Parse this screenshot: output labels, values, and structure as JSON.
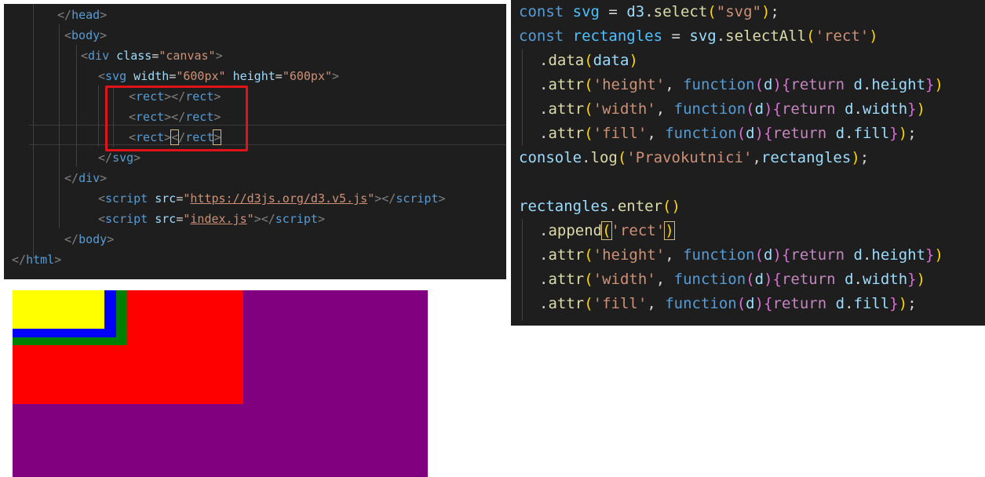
{
  "html_editor": {
    "lines": [
      [
        [
          "c-punct",
          "</"
        ],
        [
          "c-tag",
          "head"
        ],
        [
          "c-punct",
          ">"
        ]
      ],
      [
        [
          "c-punct",
          "<"
        ],
        [
          "c-tag",
          "body"
        ],
        [
          "c-punct",
          ">"
        ]
      ],
      [
        [
          "c-punct",
          "<"
        ],
        [
          "c-tag",
          "div"
        ],
        [
          "c-text",
          " "
        ],
        [
          "c-attr",
          "class"
        ],
        [
          "c-text",
          "="
        ],
        [
          "c-str",
          "\"canvas\""
        ],
        [
          "c-punct",
          ">"
        ]
      ],
      [
        [
          "c-punct",
          "<"
        ],
        [
          "c-tag",
          "svg"
        ],
        [
          "c-text",
          " "
        ],
        [
          "c-attr",
          "width"
        ],
        [
          "c-text",
          "="
        ],
        [
          "c-str",
          "\"600px\""
        ],
        [
          "c-text",
          " "
        ],
        [
          "c-attr",
          "height"
        ],
        [
          "c-text",
          "="
        ],
        [
          "c-str",
          "\"600px\""
        ],
        [
          "c-punct",
          ">"
        ]
      ],
      [
        [
          "c-punct",
          "<"
        ],
        [
          "c-tag",
          "rect"
        ],
        [
          "c-punct",
          "></"
        ],
        [
          "c-tag",
          "rect"
        ],
        [
          "c-punct",
          ">"
        ]
      ],
      [
        [
          "c-punct",
          "<"
        ],
        [
          "c-tag",
          "rect"
        ],
        [
          "c-punct",
          "></"
        ],
        [
          "c-tag",
          "rect"
        ],
        [
          "c-punct",
          ">"
        ]
      ],
      [
        [
          "c-punct",
          "<"
        ],
        [
          "c-tag",
          "rect"
        ],
        [
          "c-punct",
          ">"
        ],
        [
          "c-punct bracket-box",
          "<"
        ],
        [
          "c-punct",
          "/"
        ],
        [
          "c-tag",
          "rect"
        ],
        [
          "c-punct bracket-box",
          ">"
        ]
      ],
      [
        [
          "c-punct",
          "</"
        ],
        [
          "c-tag",
          "svg"
        ],
        [
          "c-punct",
          ">"
        ]
      ],
      [
        [
          "c-punct",
          "</"
        ],
        [
          "c-tag",
          "div"
        ],
        [
          "c-punct",
          ">"
        ]
      ],
      [
        [
          "c-punct",
          "<"
        ],
        [
          "c-tag",
          "script"
        ],
        [
          "c-text",
          " "
        ],
        [
          "c-attr",
          "src"
        ],
        [
          "c-text",
          "="
        ],
        [
          "c-str",
          "\""
        ],
        [
          "c-str c-ul",
          "https://d3js.org/d3.v5.js"
        ],
        [
          "c-str",
          "\""
        ],
        [
          "c-punct",
          "></"
        ],
        [
          "c-tag",
          "script"
        ],
        [
          "c-punct",
          ">"
        ]
      ],
      [
        [
          "c-punct",
          "<"
        ],
        [
          "c-tag",
          "script"
        ],
        [
          "c-text",
          " "
        ],
        [
          "c-attr",
          "src"
        ],
        [
          "c-text",
          "="
        ],
        [
          "c-str",
          "\""
        ],
        [
          "c-str c-ul",
          "index.js"
        ],
        [
          "c-str",
          "\""
        ],
        [
          "c-punct",
          "></"
        ],
        [
          "c-tag",
          "script"
        ],
        [
          "c-punct",
          ">"
        ]
      ],
      [
        [
          "c-punct",
          "</"
        ],
        [
          "c-tag",
          "body"
        ],
        [
          "c-punct",
          ">"
        ]
      ],
      [
        [
          "c-punct",
          "</"
        ],
        [
          "c-tag",
          "html"
        ],
        [
          "c-punct",
          ">"
        ]
      ]
    ]
  },
  "js_editor": {
    "lines": [
      [
        [
          "c-kw",
          "const"
        ],
        [
          "c-text",
          " "
        ],
        [
          "c-var",
          "svg"
        ],
        [
          "c-text",
          " = "
        ],
        [
          "c-id",
          "d3"
        ],
        [
          "c-text",
          "."
        ],
        [
          "c-fn",
          "select"
        ],
        [
          "c-p1",
          "("
        ],
        [
          "c-str",
          "\"svg\""
        ],
        [
          "c-p1",
          ")"
        ],
        [
          "c-text",
          ";"
        ]
      ],
      [
        [
          "c-kw",
          "const"
        ],
        [
          "c-text",
          " "
        ],
        [
          "c-var",
          "rectangles"
        ],
        [
          "c-text",
          " = "
        ],
        [
          "c-id",
          "svg"
        ],
        [
          "c-text",
          "."
        ],
        [
          "c-fn",
          "selectAll"
        ],
        [
          "c-p1",
          "("
        ],
        [
          "c-str",
          "'rect'"
        ],
        [
          "c-p1",
          ")"
        ]
      ],
      [
        [
          "c-text",
          "."
        ],
        [
          "c-fn",
          "data"
        ],
        [
          "c-p1",
          "("
        ],
        [
          "c-id",
          "data"
        ],
        [
          "c-p1",
          ")"
        ]
      ],
      [
        [
          "c-text",
          "."
        ],
        [
          "c-fn",
          "attr"
        ],
        [
          "c-p1",
          "("
        ],
        [
          "c-str",
          "'height'"
        ],
        [
          "c-text",
          ", "
        ],
        [
          "c-kw",
          "function"
        ],
        [
          "c-p2",
          "("
        ],
        [
          "c-id",
          "d"
        ],
        [
          "c-p2",
          ")"
        ],
        [
          "c-p2",
          "{"
        ],
        [
          "c-ctrl",
          "return"
        ],
        [
          "c-text",
          " "
        ],
        [
          "c-id",
          "d"
        ],
        [
          "c-text",
          "."
        ],
        [
          "c-id",
          "height"
        ],
        [
          "c-p2",
          "}"
        ],
        [
          "c-p1",
          ")"
        ]
      ],
      [
        [
          "c-text",
          "."
        ],
        [
          "c-fn",
          "attr"
        ],
        [
          "c-p1",
          "("
        ],
        [
          "c-str",
          "'width'"
        ],
        [
          "c-text",
          ", "
        ],
        [
          "c-kw",
          "function"
        ],
        [
          "c-p2",
          "("
        ],
        [
          "c-id",
          "d"
        ],
        [
          "c-p2",
          ")"
        ],
        [
          "c-p2",
          "{"
        ],
        [
          "c-ctrl",
          "return"
        ],
        [
          "c-text",
          " "
        ],
        [
          "c-id",
          "d"
        ],
        [
          "c-text",
          "."
        ],
        [
          "c-id",
          "width"
        ],
        [
          "c-p2",
          "}"
        ],
        [
          "c-p1",
          ")"
        ]
      ],
      [
        [
          "c-text",
          "."
        ],
        [
          "c-fn",
          "attr"
        ],
        [
          "c-p1",
          "("
        ],
        [
          "c-str",
          "'fill'"
        ],
        [
          "c-text",
          ", "
        ],
        [
          "c-kw",
          "function"
        ],
        [
          "c-p2",
          "("
        ],
        [
          "c-id",
          "d"
        ],
        [
          "c-p2",
          ")"
        ],
        [
          "c-p2",
          "{"
        ],
        [
          "c-ctrl",
          "return"
        ],
        [
          "c-text",
          " "
        ],
        [
          "c-id",
          "d"
        ],
        [
          "c-text",
          "."
        ],
        [
          "c-id",
          "fill"
        ],
        [
          "c-p2",
          "}"
        ],
        [
          "c-p1",
          ")"
        ],
        [
          "c-text",
          ";"
        ]
      ],
      [
        [
          "c-id",
          "console"
        ],
        [
          "c-text",
          "."
        ],
        [
          "c-fn",
          "log"
        ],
        [
          "c-p1",
          "("
        ],
        [
          "c-str",
          "'Pravokutnici'"
        ],
        [
          "c-text",
          ","
        ],
        [
          "c-id",
          "rectangles"
        ],
        [
          "c-p1",
          ")"
        ],
        [
          "c-text",
          ";"
        ]
      ],
      [],
      [
        [
          "c-id",
          "rectangles"
        ],
        [
          "c-text",
          "."
        ],
        [
          "c-fn",
          "enter"
        ],
        [
          "c-p1",
          "("
        ],
        [
          "c-p1",
          ")"
        ]
      ],
      [
        [
          "c-text",
          "."
        ],
        [
          "c-fn",
          "append"
        ],
        [
          "c-p1 bracket-box",
          "("
        ],
        [
          "c-str",
          "'rect'"
        ],
        [
          "c-p1 bracket-box",
          ")"
        ]
      ],
      [
        [
          "c-text",
          "."
        ],
        [
          "c-fn",
          "attr"
        ],
        [
          "c-p1",
          "("
        ],
        [
          "c-str",
          "'height'"
        ],
        [
          "c-text",
          ", "
        ],
        [
          "c-kw",
          "function"
        ],
        [
          "c-p2",
          "("
        ],
        [
          "c-id",
          "d"
        ],
        [
          "c-p2",
          ")"
        ],
        [
          "c-p2",
          "{"
        ],
        [
          "c-ctrl",
          "return"
        ],
        [
          "c-text",
          " "
        ],
        [
          "c-id",
          "d"
        ],
        [
          "c-text",
          "."
        ],
        [
          "c-id",
          "height"
        ],
        [
          "c-p2",
          "}"
        ],
        [
          "c-p1",
          ")"
        ]
      ],
      [
        [
          "c-text",
          "."
        ],
        [
          "c-fn",
          "attr"
        ],
        [
          "c-p1",
          "("
        ],
        [
          "c-str",
          "'width'"
        ],
        [
          "c-text",
          ", "
        ],
        [
          "c-kw",
          "function"
        ],
        [
          "c-p2",
          "("
        ],
        [
          "c-id",
          "d"
        ],
        [
          "c-p2",
          ")"
        ],
        [
          "c-p2",
          "{"
        ],
        [
          "c-ctrl",
          "return"
        ],
        [
          "c-text",
          " "
        ],
        [
          "c-id",
          "d"
        ],
        [
          "c-text",
          "."
        ],
        [
          "c-id",
          "width"
        ],
        [
          "c-p2",
          "}"
        ],
        [
          "c-p1",
          ")"
        ]
      ],
      [
        [
          "c-text",
          "."
        ],
        [
          "c-fn",
          "attr"
        ],
        [
          "c-p1",
          "("
        ],
        [
          "c-str",
          "'fill'"
        ],
        [
          "c-text",
          ", "
        ],
        [
          "c-kw",
          "function"
        ],
        [
          "c-p2",
          "("
        ],
        [
          "c-id",
          "d"
        ],
        [
          "c-p2",
          ")"
        ],
        [
          "c-p2",
          "{"
        ],
        [
          "c-ctrl",
          "return"
        ],
        [
          "c-text",
          " "
        ],
        [
          "c-id",
          "d"
        ],
        [
          "c-text",
          "."
        ],
        [
          "c-id",
          "fill"
        ],
        [
          "c-p2",
          "}"
        ],
        [
          "c-p1",
          ")"
        ],
        [
          "c-text",
          ";"
        ]
      ]
    ]
  },
  "rendered_output": {
    "background": "#800080",
    "rects": [
      {
        "fill": "#ff0000"
      },
      {
        "fill": "#008000"
      },
      {
        "fill": "#0000ff"
      },
      {
        "fill": "#ffff00"
      }
    ]
  },
  "colors": {
    "highlight": "#e0131a",
    "editor_bg": "#1e1e1e"
  }
}
